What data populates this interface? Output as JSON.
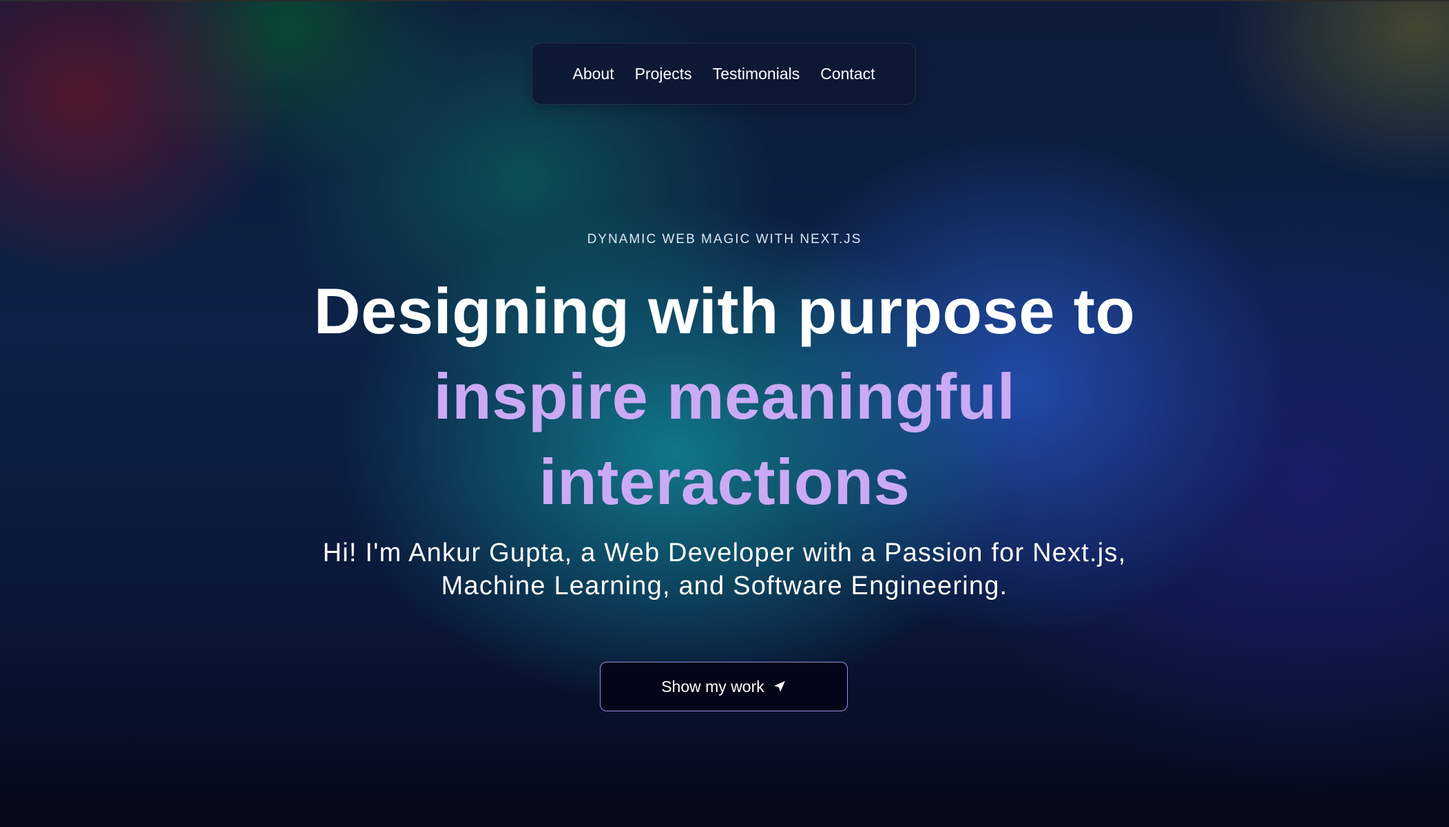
{
  "nav": {
    "items": [
      "About",
      "Projects",
      "Testimonials",
      "Contact"
    ]
  },
  "hero": {
    "eyebrow": "DYNAMIC WEB MAGIC WITH NEXT.JS",
    "headline_line1": "Designing with purpose to",
    "headline_line2": "inspire meaningful",
    "headline_line3": "interactions",
    "intro_line1": "Hi! I'm Ankur Gupta, a Web Developer with a Passion for Next.js,",
    "intro_line2": "Machine Learning, and Software Engineering.",
    "cta_label": "Show my work",
    "cta_icon": "send-icon"
  },
  "colors": {
    "headline_white": "#ffffff",
    "headline_accent": "#cbaaf5",
    "cta_border": "#9c8be6",
    "cta_background": "#030518",
    "nav_background": "#0d1834"
  }
}
